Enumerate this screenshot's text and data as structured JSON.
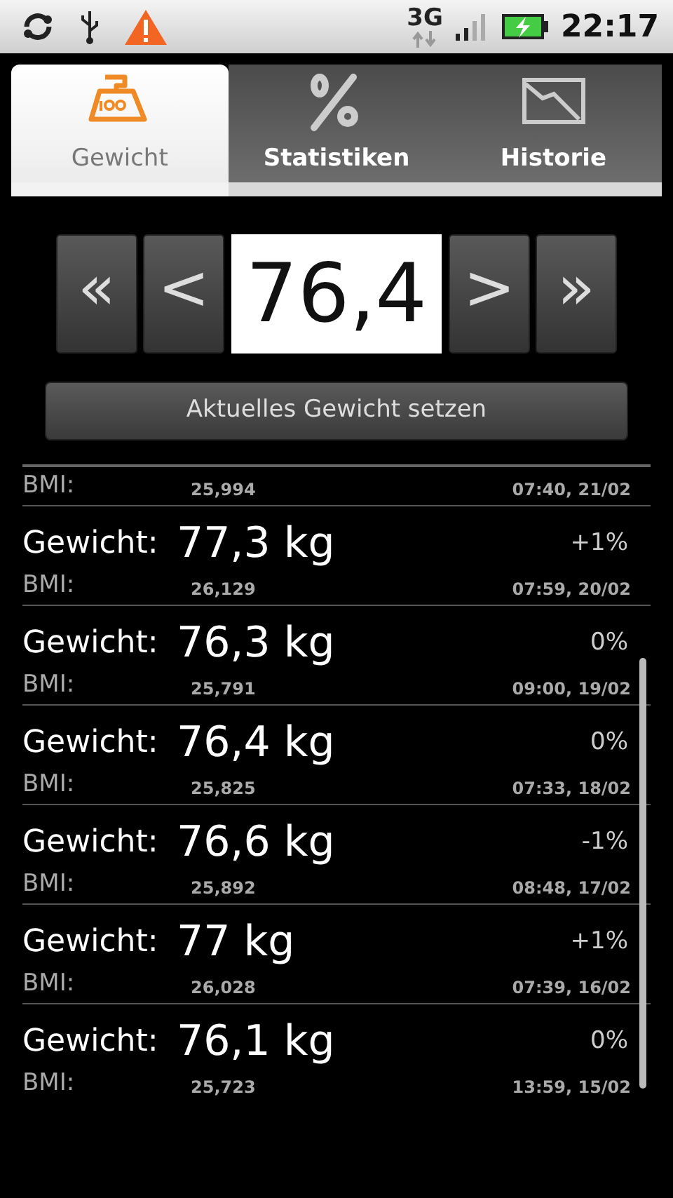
{
  "status_bar": {
    "network": "3G",
    "time": "22:17"
  },
  "tabs": [
    {
      "label": "Gewicht",
      "kind": "weight",
      "selected": true
    },
    {
      "label": "Statistiken",
      "kind": "percent",
      "selected": false
    },
    {
      "label": "Historie",
      "kind": "chart",
      "selected": false
    }
  ],
  "stepper": {
    "buttons_left": [
      "«",
      "<"
    ],
    "value": "76,4",
    "buttons_right": [
      ">",
      "»"
    ]
  },
  "set_button": "Aktuelles Gewicht setzen",
  "entries": [
    {
      "bmi_label": "BMI:",
      "bmi": "25,994",
      "time": "07:40, 21/02"
    },
    {
      "weight_label": "Gewicht:",
      "weight": "77,3 kg",
      "change": "+1%",
      "bmi_label": "BMI:",
      "bmi": "26,129",
      "time": "07:59, 20/02"
    },
    {
      "weight_label": "Gewicht:",
      "weight": "76,3 kg",
      "change": "0%",
      "bmi_label": "BMI:",
      "bmi": "25,791",
      "time": "09:00, 19/02"
    },
    {
      "weight_label": "Gewicht:",
      "weight": "76,4 kg",
      "change": "0%",
      "bmi_label": "BMI:",
      "bmi": "25,825",
      "time": "07:33, 18/02"
    },
    {
      "weight_label": "Gewicht:",
      "weight": "76,6 kg",
      "change": "-1%",
      "bmi_label": "BMI:",
      "bmi": "25,892",
      "time": "08:48, 17/02"
    },
    {
      "weight_label": "Gewicht:",
      "weight": "77 kg",
      "change": "+1%",
      "bmi_label": "BMI:",
      "bmi": "26,028",
      "time": "07:39, 16/02"
    },
    {
      "weight_label": "Gewicht:",
      "weight": "76,1 kg",
      "change": "0%",
      "bmi_label": "BMI:",
      "bmi": "25,723",
      "time": "13:59, 15/02"
    }
  ]
}
